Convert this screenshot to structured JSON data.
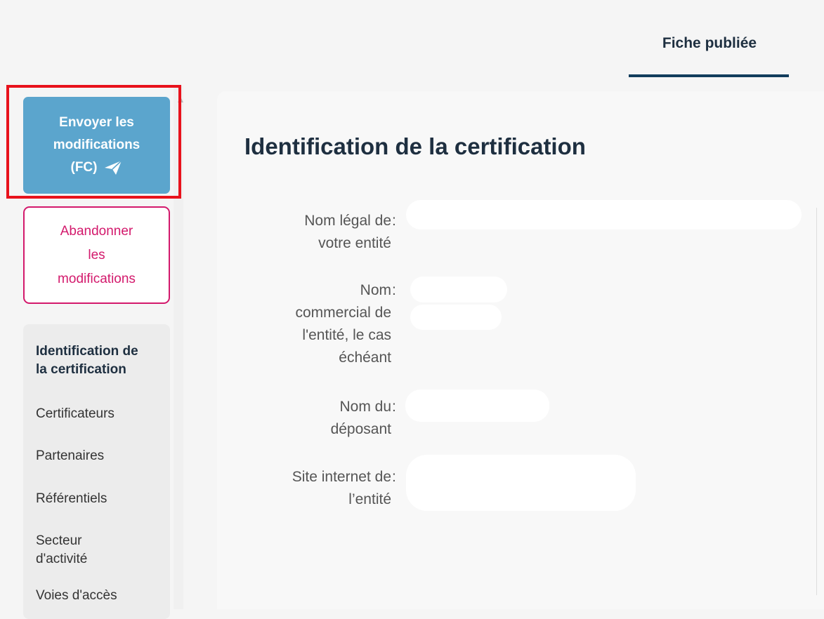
{
  "header": {
    "tab_published": "Fiche publiée"
  },
  "actions": {
    "send_line1": "Envoyer les",
    "send_line2": "modifications",
    "send_line3": "(FC)",
    "send_icon": "paper-plane-icon",
    "cancel_line1": "Abandonner",
    "cancel_line2": "les",
    "cancel_line3": "modifications"
  },
  "sidebar": {
    "items": [
      {
        "line1": "Identification de",
        "line2": "la certification",
        "active": true
      },
      {
        "line1": "Certificateurs",
        "line2": ""
      },
      {
        "line1": "Partenaires",
        "line2": ""
      },
      {
        "line1": "Référentiels",
        "line2": ""
      },
      {
        "line1": "Secteur",
        "line2": "d'activité"
      },
      {
        "line1": "Voies d'accès",
        "line2": ""
      }
    ]
  },
  "main": {
    "title": "Identification de la certification",
    "fields": [
      {
        "label_lines": [
          "Nom légal de",
          "votre entité"
        ],
        "separator": ":",
        "value": ""
      },
      {
        "label_lines": [
          "Nom",
          "commercial de",
          "l'entité, le cas",
          "échéant"
        ],
        "separator": ":",
        "value": ""
      },
      {
        "label_lines": [
          "Nom du",
          "déposant"
        ],
        "separator": ":",
        "value": ""
      },
      {
        "label_lines": [
          "Site internet de",
          "l’entité"
        ],
        "separator": ":",
        "value": ""
      }
    ]
  },
  "colors": {
    "accent_send": "#5ba5cd",
    "accent_cancel": "#d3196c",
    "title": "#1e2f40",
    "highlight": "#e8121c"
  }
}
